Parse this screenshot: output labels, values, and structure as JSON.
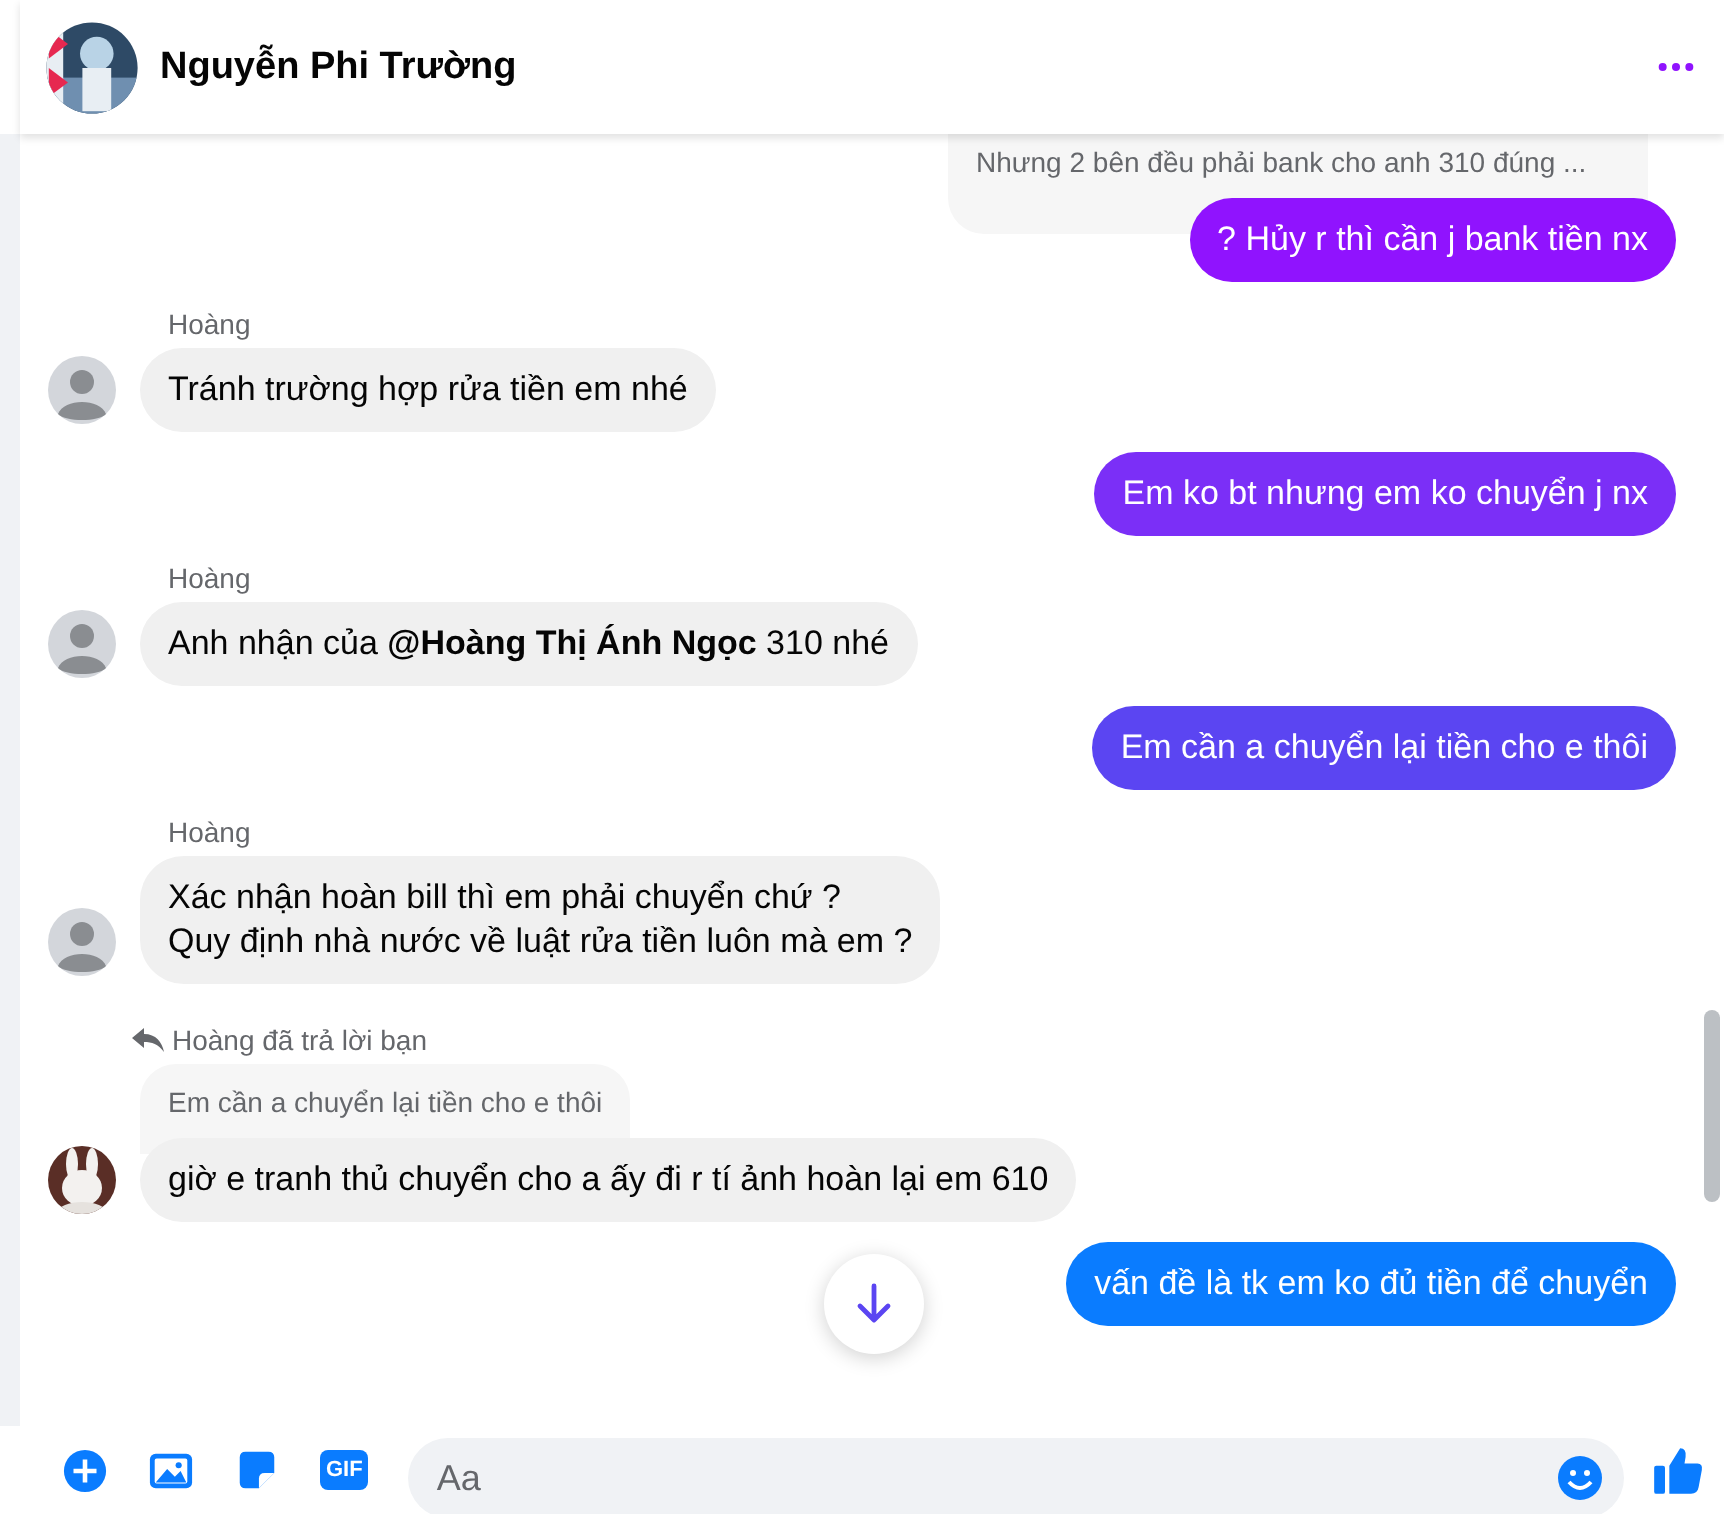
{
  "header": {
    "name": "Nguyễn Phi Trường"
  },
  "messages": [
    {
      "kind": "quote",
      "text": "Nhưng 2 bên đều phải bank cho anh 310 đúng ..."
    },
    {
      "kind": "out",
      "text": "? Hủy r thì cần j bank tiền nx",
      "color": "#9013fe"
    },
    {
      "kind": "in",
      "sender": "Hoàng",
      "text": "Tránh trường hợp rửa tiền em nhé",
      "avatar_photo": false
    },
    {
      "kind": "out",
      "text": "Em ko bt nhưng em ko chuyển j nx",
      "color": "#7b2ff7"
    },
    {
      "kind": "in",
      "sender": "Hoàng",
      "text": "Anh nhận của **@Hoàng Thị Ánh Ngọc** 310 nhé",
      "avatar_photo": false
    },
    {
      "kind": "out",
      "text": "Em cần a chuyển lại tiền cho e thôi",
      "color": "#5b45f2"
    },
    {
      "kind": "in",
      "sender": "Hoàng",
      "text": "Xác nhận hoàn bill thì em phải chuyển chứ ?\nQuy định nhà nước về luật rửa tiền luôn mà em ?",
      "avatar_photo": false
    },
    {
      "kind": "reply",
      "note": "Hoàng đã trả lời bạn",
      "quote": "Em cần a chuyển lại tiền cho e thôi",
      "text": "giờ e tranh thủ chuyển cho a ấy đi r tí ảnh hoàn lại em 610",
      "avatar_photo": true
    },
    {
      "kind": "out",
      "text": "vấn đề là tk em ko đủ tiền để chuyển",
      "color": "#0a7cff"
    }
  ],
  "composer": {
    "gif": "GIF",
    "placeholder": "Aa"
  }
}
